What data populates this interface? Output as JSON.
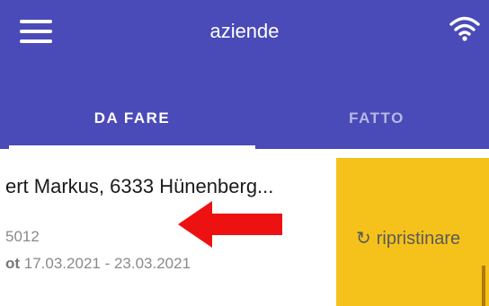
{
  "header": {
    "title": "aziende"
  },
  "tabs": [
    {
      "label": "DA FARE",
      "selected": true
    },
    {
      "label": "FATTO",
      "selected": false
    }
  ],
  "card": {
    "title": "ert Markus, 6333 Hünenberg...",
    "line1": "5012",
    "line2_label": "ot",
    "line2_value": " 17.03.2021 - 23.03.2021"
  },
  "swipe_action": {
    "icon": "refresh-icon",
    "label": "ripristinare"
  },
  "colors": {
    "appbar": "#4a4ab8",
    "action": "#f5c21b",
    "arrow": "#ee1111"
  }
}
